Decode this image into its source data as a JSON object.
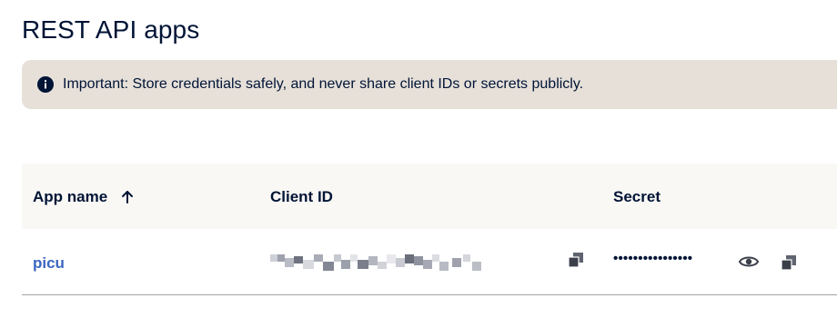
{
  "page": {
    "title": "REST API apps"
  },
  "alert": {
    "icon": "info-icon",
    "text": "Important: Store credentials safely, and never share client IDs or secrets publicly."
  },
  "table": {
    "columns": [
      {
        "label": "App name",
        "sort": "ascending"
      },
      {
        "label": "Client ID"
      },
      {
        "label": "Secret"
      }
    ],
    "rows": [
      {
        "app_name": "picu",
        "client_id": "",
        "secret": "••••••••••••••••"
      }
    ]
  },
  "colors": {
    "alert_bg": "#e6e0d9",
    "header_bg": "#faf8f5",
    "link": "#3b65c0",
    "text": "#001435"
  }
}
